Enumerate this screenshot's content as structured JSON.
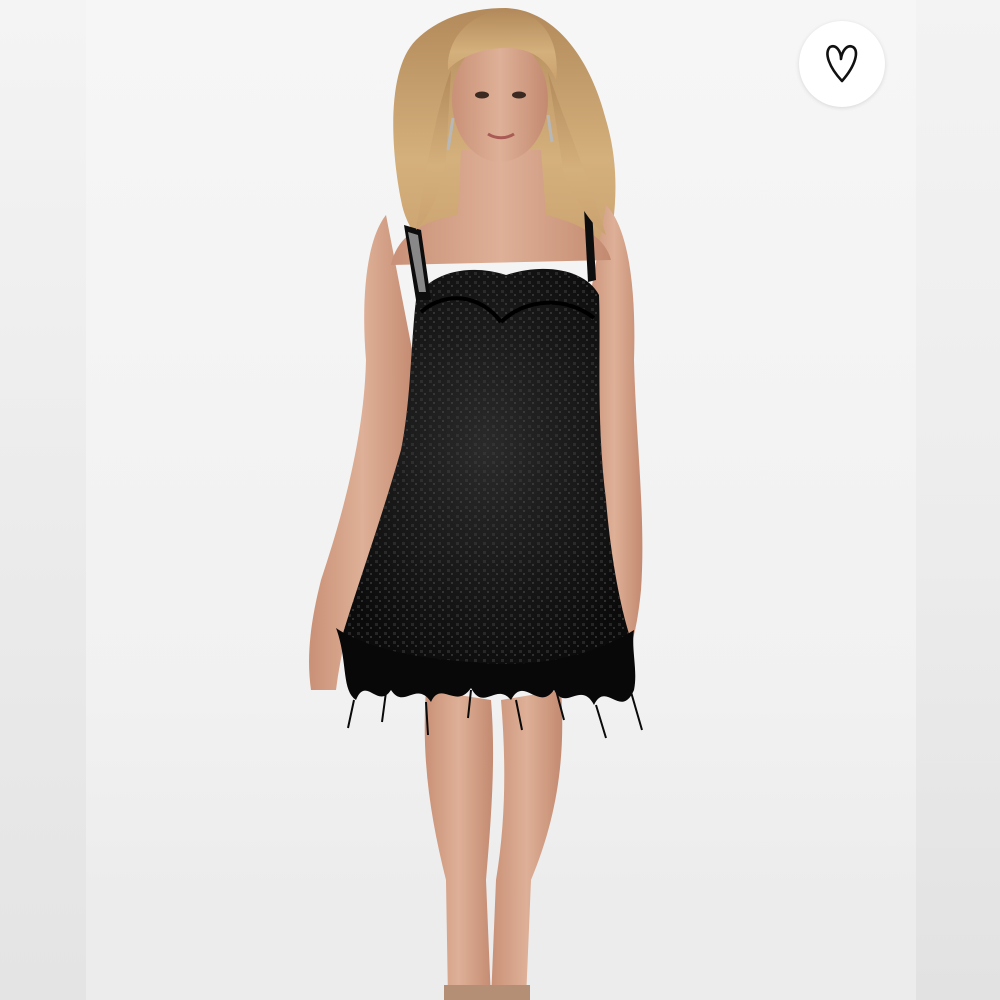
{
  "listing": {
    "product_image_alt": "",
    "image_colors": {
      "backdrop": "#f2f2f2",
      "dress": "#111111",
      "skin": "#d9a98d",
      "hair": "#c9a06a"
    }
  },
  "like_button": {
    "icon": "heart-outline-icon",
    "state": "not-liked",
    "color": "#111111"
  }
}
